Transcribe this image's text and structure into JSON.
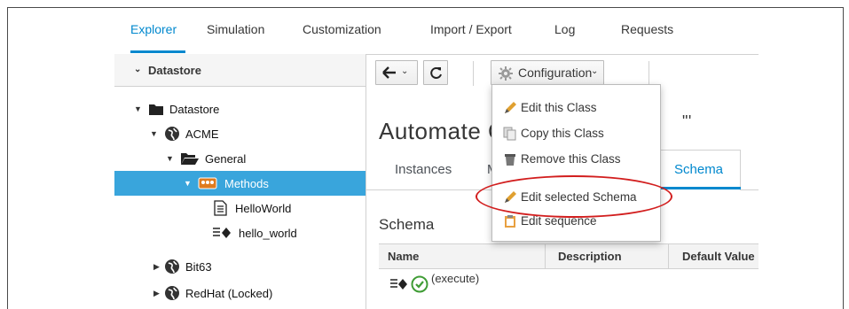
{
  "nav": {
    "items": [
      "Explorer",
      "Simulation",
      "Customization",
      "Import / Export",
      "Log",
      "Requests"
    ],
    "active": "Explorer"
  },
  "accordion": {
    "title": "Datastore"
  },
  "tree": [
    {
      "label": "Datastore",
      "icon": "folder-icon",
      "state": "expanded"
    },
    {
      "label": "ACME",
      "icon": "globe-icon",
      "state": "expanded"
    },
    {
      "label": "General",
      "icon": "folder-open-icon",
      "state": "expanded"
    },
    {
      "label": "Methods",
      "icon": "class-icon",
      "state": "expanded",
      "selected": true
    },
    {
      "label": "HelloWorld",
      "icon": "document-icon"
    },
    {
      "label": "hello_world",
      "icon": "method-icon"
    },
    {
      "label": "Bit63",
      "icon": "globe-icon",
      "state": "collapsed"
    },
    {
      "label": "RedHat (Locked)",
      "icon": "globe-icon",
      "state": "collapsed"
    }
  ],
  "toolbar": {
    "back_icon": "arrow-left-icon",
    "refresh_icon": "refresh-icon",
    "config_label": "Configuration",
    "config_icon": "gear-icon"
  },
  "main": {
    "title_visible": "Automate C",
    "title_fragment": "\"'",
    "tabs": [
      "Instances",
      "M",
      "Schema"
    ],
    "active_tab": "Schema",
    "section_title": "Schema",
    "columns": [
      "Name",
      "Description",
      "Default Value"
    ],
    "rows": [
      {
        "name": "(execute)"
      }
    ]
  },
  "config_menu": {
    "items": [
      {
        "label": "Edit this Class",
        "icon": "pencil-icon"
      },
      {
        "label": "Copy this Class",
        "icon": "copy-icon"
      },
      {
        "label": "Remove this Class",
        "icon": "trash-icon"
      },
      {
        "label": "Edit selected Schema",
        "icon": "pencil-icon",
        "highlighted": true
      },
      {
        "label": "Edit sequence",
        "icon": "clipboard-icon"
      }
    ]
  },
  "colors": {
    "accent": "#0088ce",
    "selection": "#39a5dc",
    "annotation": "#d21e1e"
  }
}
